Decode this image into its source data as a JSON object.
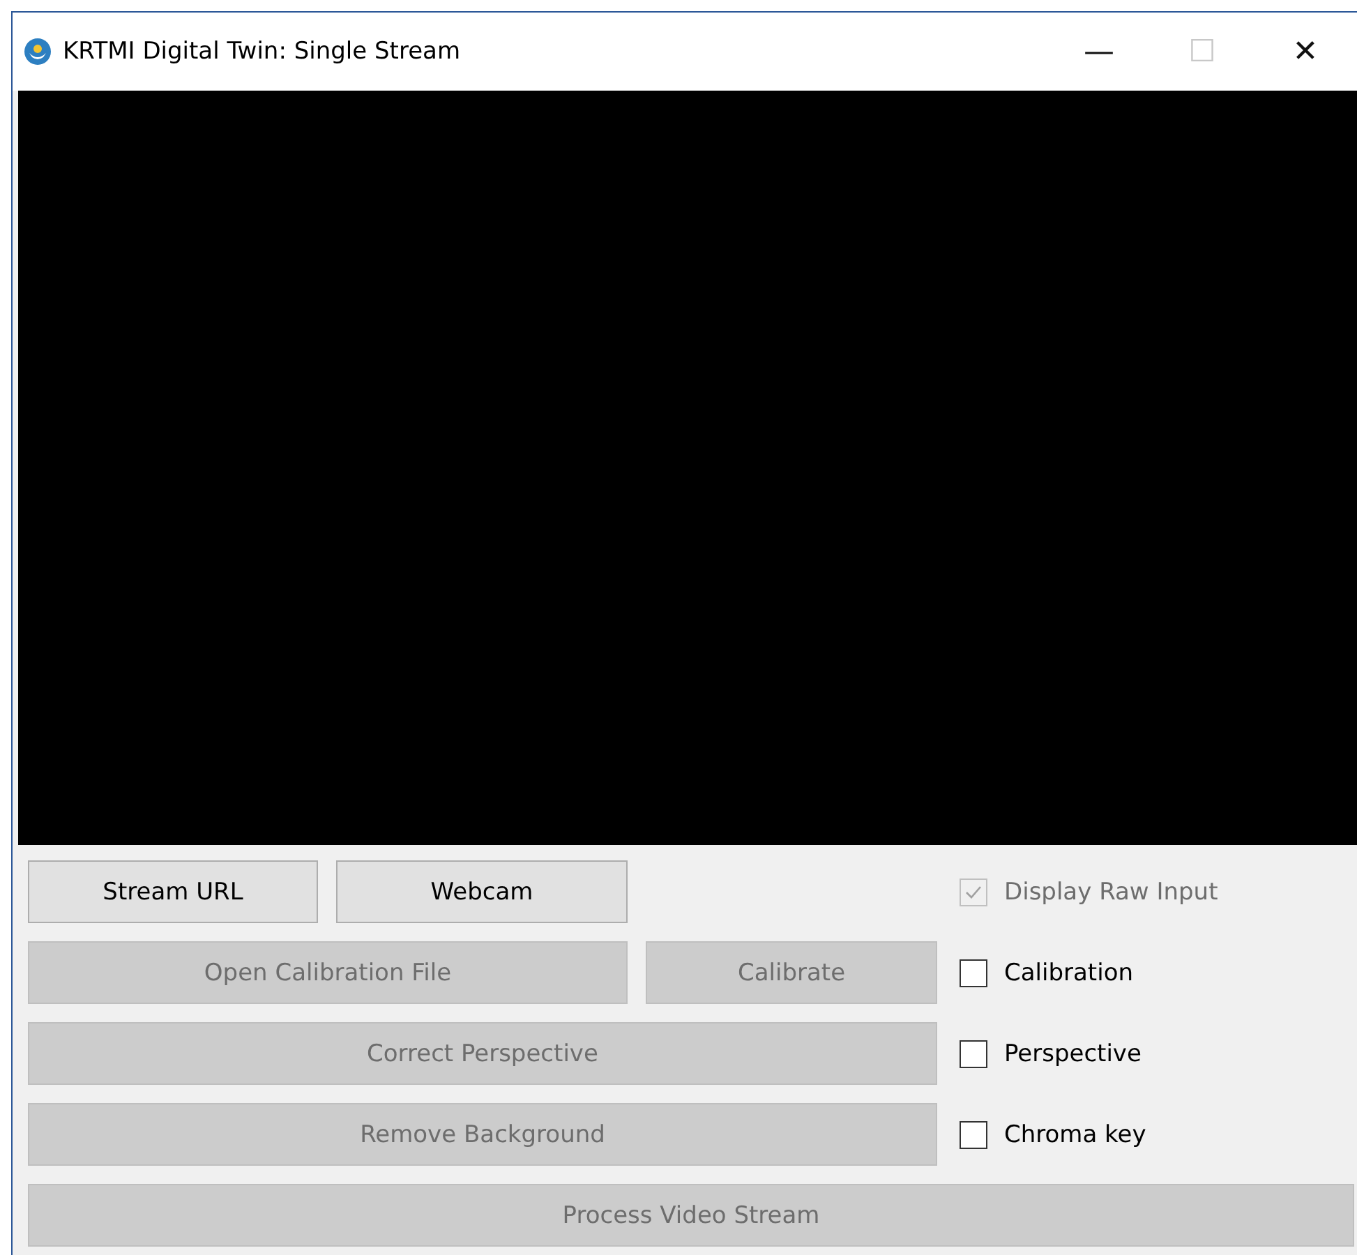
{
  "window": {
    "title": "KRTMI Digital Twin: Single Stream",
    "controls": [
      "—",
      "☐",
      "✕"
    ]
  },
  "video": {
    "kind": "blank"
  },
  "rows": [
    {
      "buttons": [
        {
          "label": "Stream URL",
          "disabled": false
        },
        {
          "label": "Webcam",
          "disabled": false
        }
      ],
      "checkbox": {
        "label": "Display Raw Input",
        "checked": true,
        "disabled": true
      }
    },
    {
      "buttons": [
        {
          "label": "Open Calibration File",
          "disabled": true
        },
        {
          "label": "Calibrate",
          "disabled": true
        }
      ],
      "checkbox": {
        "label": "Calibration",
        "checked": false,
        "disabled": false
      }
    },
    {
      "buttons": [
        {
          "label": "Correct Perspective",
          "disabled": true
        }
      ],
      "checkbox": {
        "label": "Perspective",
        "checked": false,
        "disabled": false
      }
    },
    {
      "buttons": [
        {
          "label": "Remove Background",
          "disabled": true
        }
      ],
      "checkbox": {
        "label": "Chroma key",
        "checked": false,
        "disabled": false
      }
    }
  ],
  "process_button": {
    "label": "Process Video Stream",
    "disabled": true
  }
}
